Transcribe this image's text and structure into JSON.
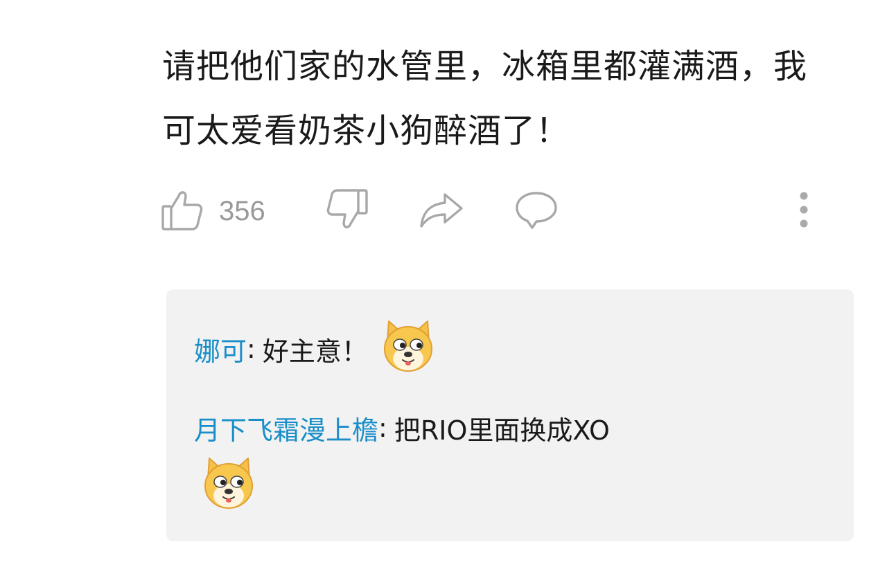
{
  "comment": {
    "text": "请把他们家的水管里，冰箱里都灌满酒，我可太爱看奶茶小狗醉酒了！"
  },
  "actions": {
    "like_icon": "thumbs-up-icon",
    "like_count": "356",
    "dislike_icon": "thumbs-down-icon",
    "share_icon": "share-icon",
    "reply_icon": "comment-bubble-icon",
    "more_icon": "more-vertical-icon"
  },
  "replies": [
    {
      "user": "娜可",
      "separator": ":",
      "text": "好主意！",
      "emoji": "doge-emoji"
    },
    {
      "user": "月下飞霜漫上檐",
      "separator": ":",
      "text": "把RIO里面换成XO",
      "emoji": "doge-emoji"
    }
  ],
  "colors": {
    "username": "#1a8ec9",
    "text": "#1a1a1a",
    "icon": "#aaaaaa",
    "reply_bg": "#f2f2f2"
  }
}
